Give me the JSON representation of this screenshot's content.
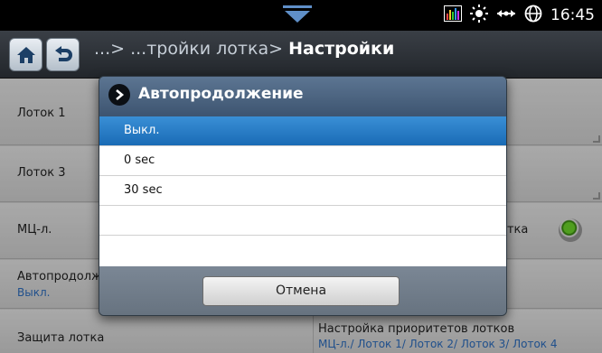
{
  "status": {
    "time": "16:45"
  },
  "header": {
    "breadcrumb_prefix": "...> ...тройки лотка>",
    "breadcrumb_current": "Настройки"
  },
  "settings": {
    "tray1": "Лоток 1",
    "tray3": "Лоток 3",
    "mp_tray": "МЦ-л.",
    "mp_right_fragment": "отка",
    "auto_continue": "Автопродолж",
    "auto_continue_value": "Выкл.",
    "tray_protect": "Защита лотка",
    "tray_priority": "Настройка приоритетов лотков",
    "tray_priority_value": "МЦ-л./ Лоток 1/ Лоток 2/ Лоток 3/ Лоток 4"
  },
  "dialog": {
    "title": "Автопродолжение",
    "options": [
      "Выкл.",
      "0 sec",
      "30 sec",
      "",
      ""
    ],
    "selected_index": 0,
    "cancel_label": "Отмена"
  },
  "colors": {
    "accent": "#1a6bb5",
    "radio_on": "#4caf1a"
  },
  "icons": [
    "home-icon",
    "back-icon",
    "chevron-right-icon",
    "graph-icon",
    "brightness-icon",
    "network-icon",
    "globe-icon",
    "down-arrow-icon"
  ]
}
